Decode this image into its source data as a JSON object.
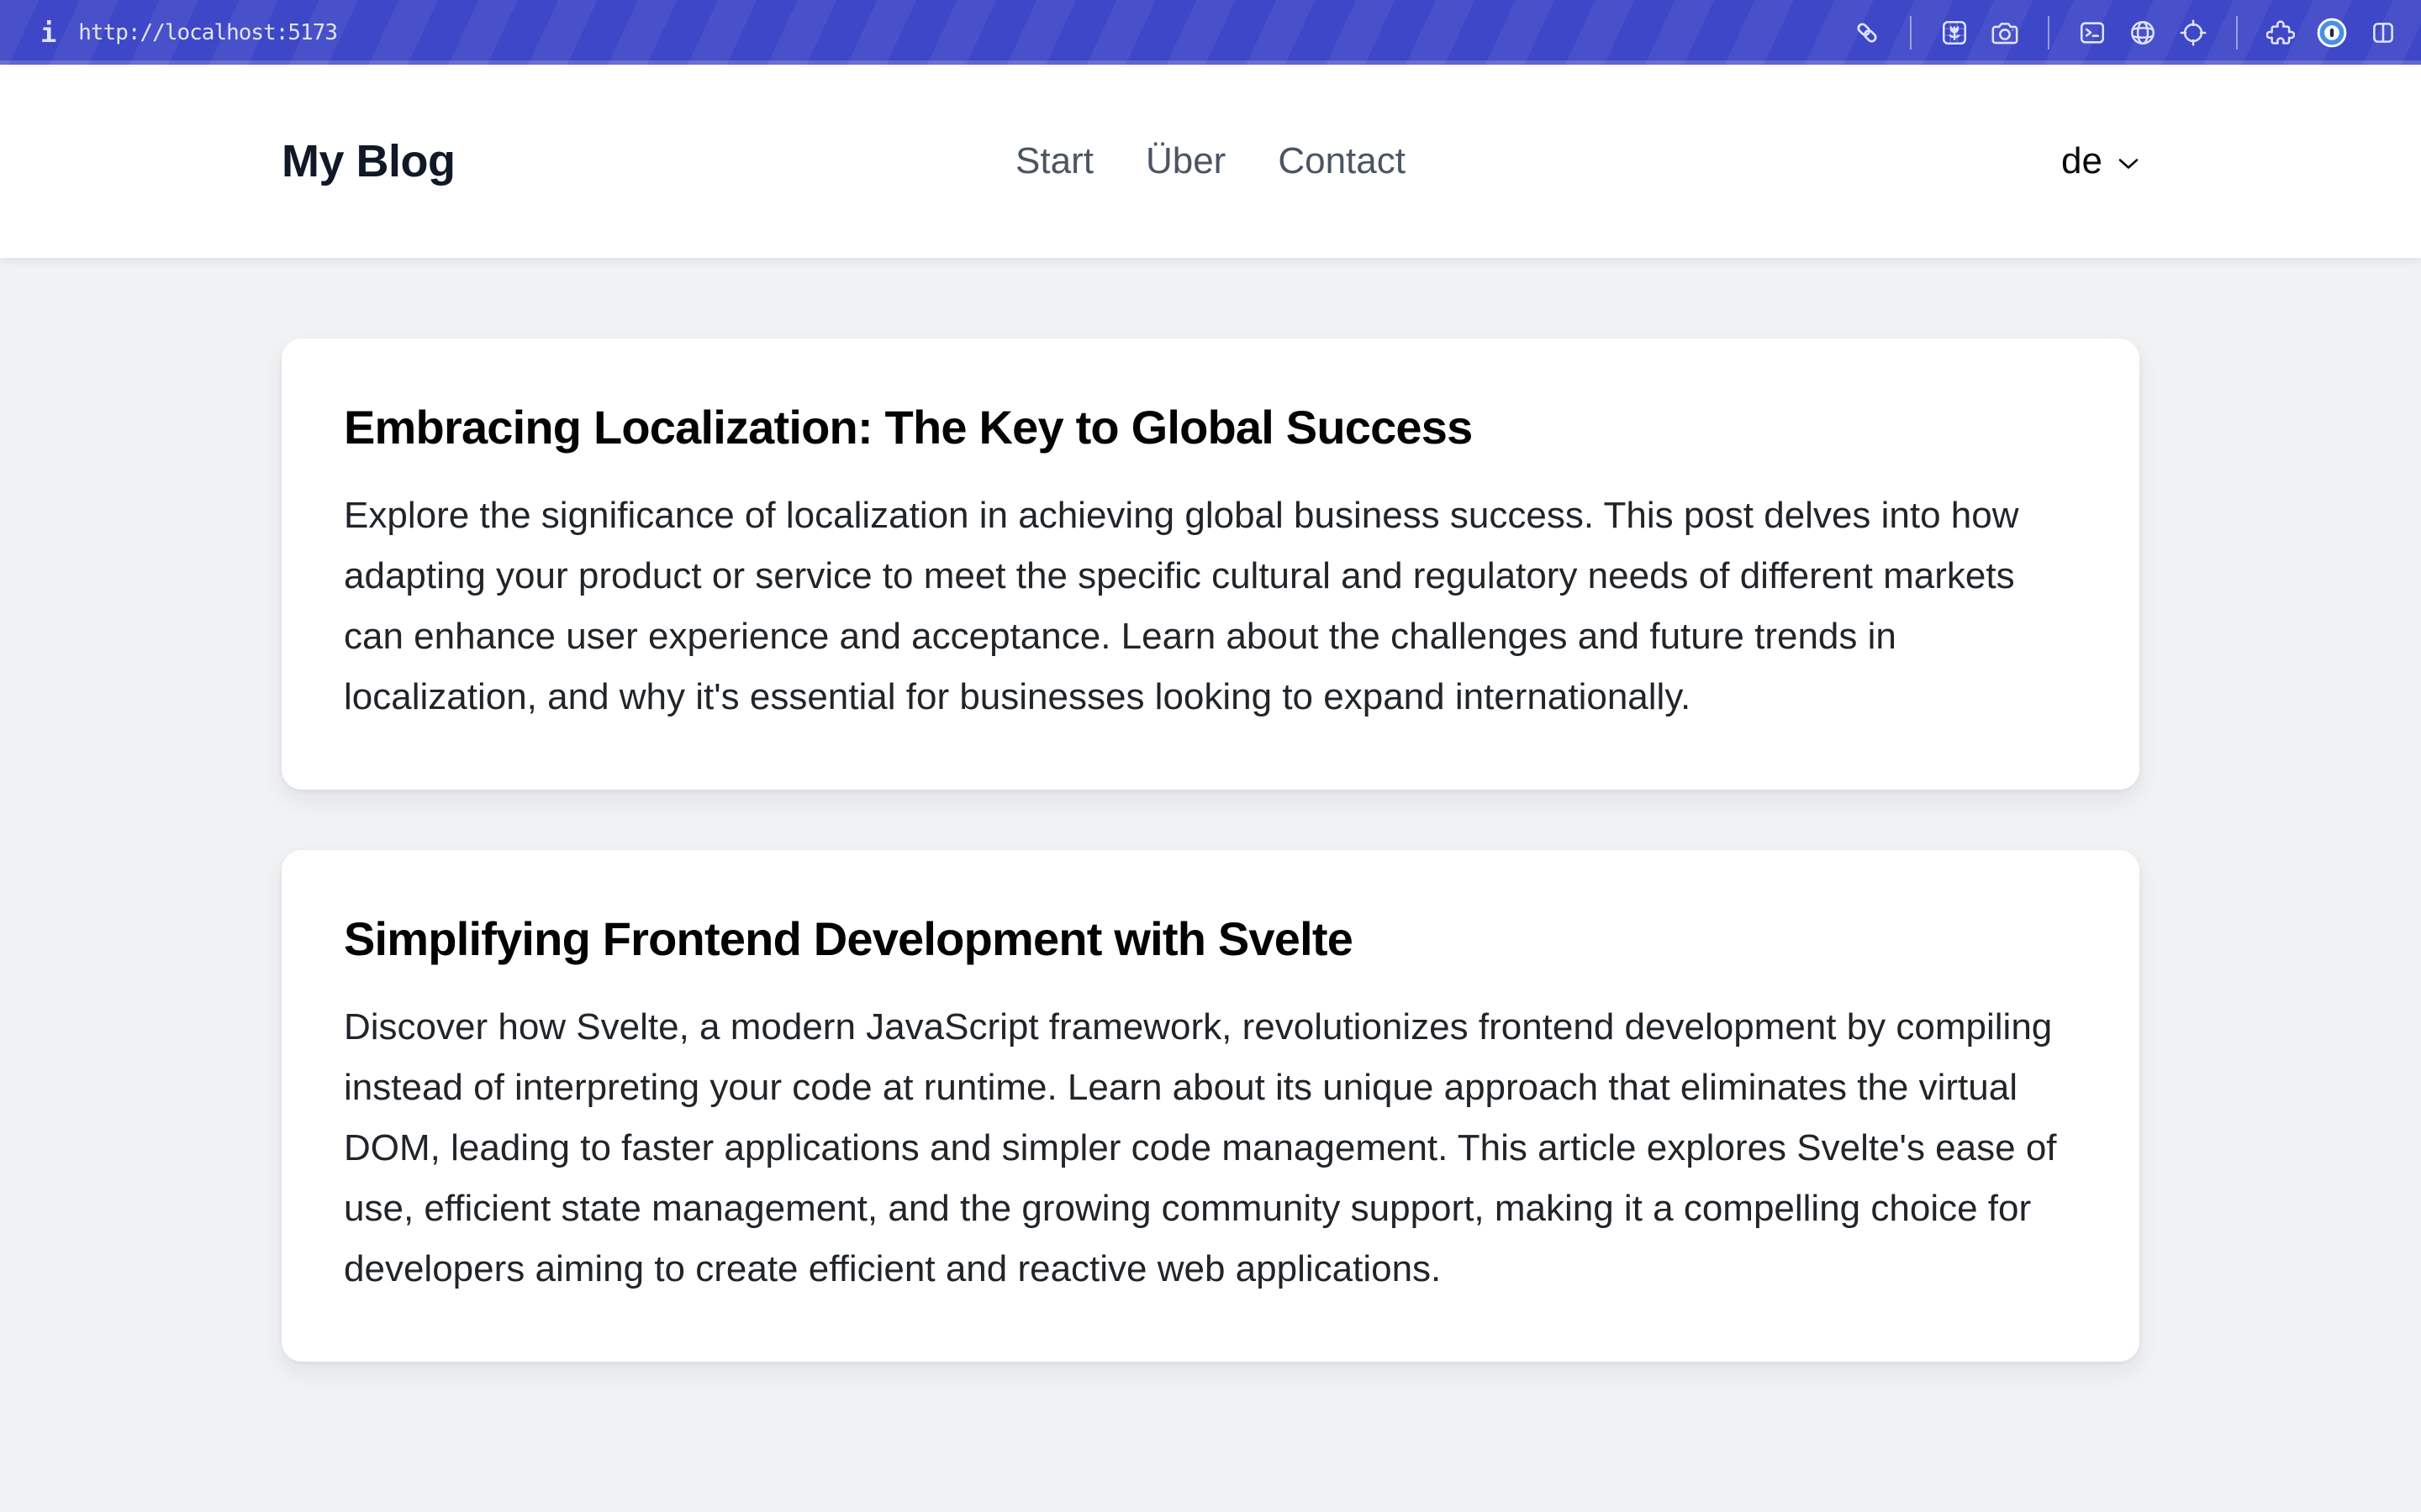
{
  "browser": {
    "info_glyph": "i",
    "url": "http://localhost:5173",
    "toolbar_icons": [
      "link-icon",
      "flower-image-icon",
      "camera-icon",
      "terminal-icon",
      "globe-icon",
      "crosshair-icon",
      "puzzle-icon",
      "onepassword-icon",
      "split-view-icon"
    ],
    "colors": {
      "bar_background": "#3e47c7",
      "icon_color": "#dfe3fb",
      "onepassword_blue": "#4a90e2"
    }
  },
  "header": {
    "site_title": "My Blog",
    "nav": [
      {
        "label": "Start"
      },
      {
        "label": "Über"
      },
      {
        "label": "Contact"
      }
    ],
    "language": {
      "selected": "de",
      "chevron": "chevron-down-icon"
    }
  },
  "posts": [
    {
      "title": "Embracing Localization: The Key to Global Success",
      "excerpt": "Explore the significance of localization in achieving global business success. This post delves into how adapting your product or service to meet the specific cultural and regulatory needs of different markets can enhance user experience and acceptance. Learn about the challenges and future trends in localization, and why it's essential for businesses looking to expand internationally."
    },
    {
      "title": "Simplifying Frontend Development with Svelte",
      "excerpt": "Discover how Svelte, a modern JavaScript framework, revolutionizes frontend development by compiling instead of interpreting your code at runtime. Learn about its unique approach that eliminates the virtual DOM, leading to faster applications and simpler code management. This article explores Svelte's ease of use, efficient state management, and the growing community support, making it a compelling choice for developers aiming to create efficient and reactive web applications."
    }
  ],
  "colors": {
    "page_background": "#f1f2f4",
    "card_background": "#ffffff",
    "nav_text": "#4b5563",
    "body_text": "#212529"
  }
}
